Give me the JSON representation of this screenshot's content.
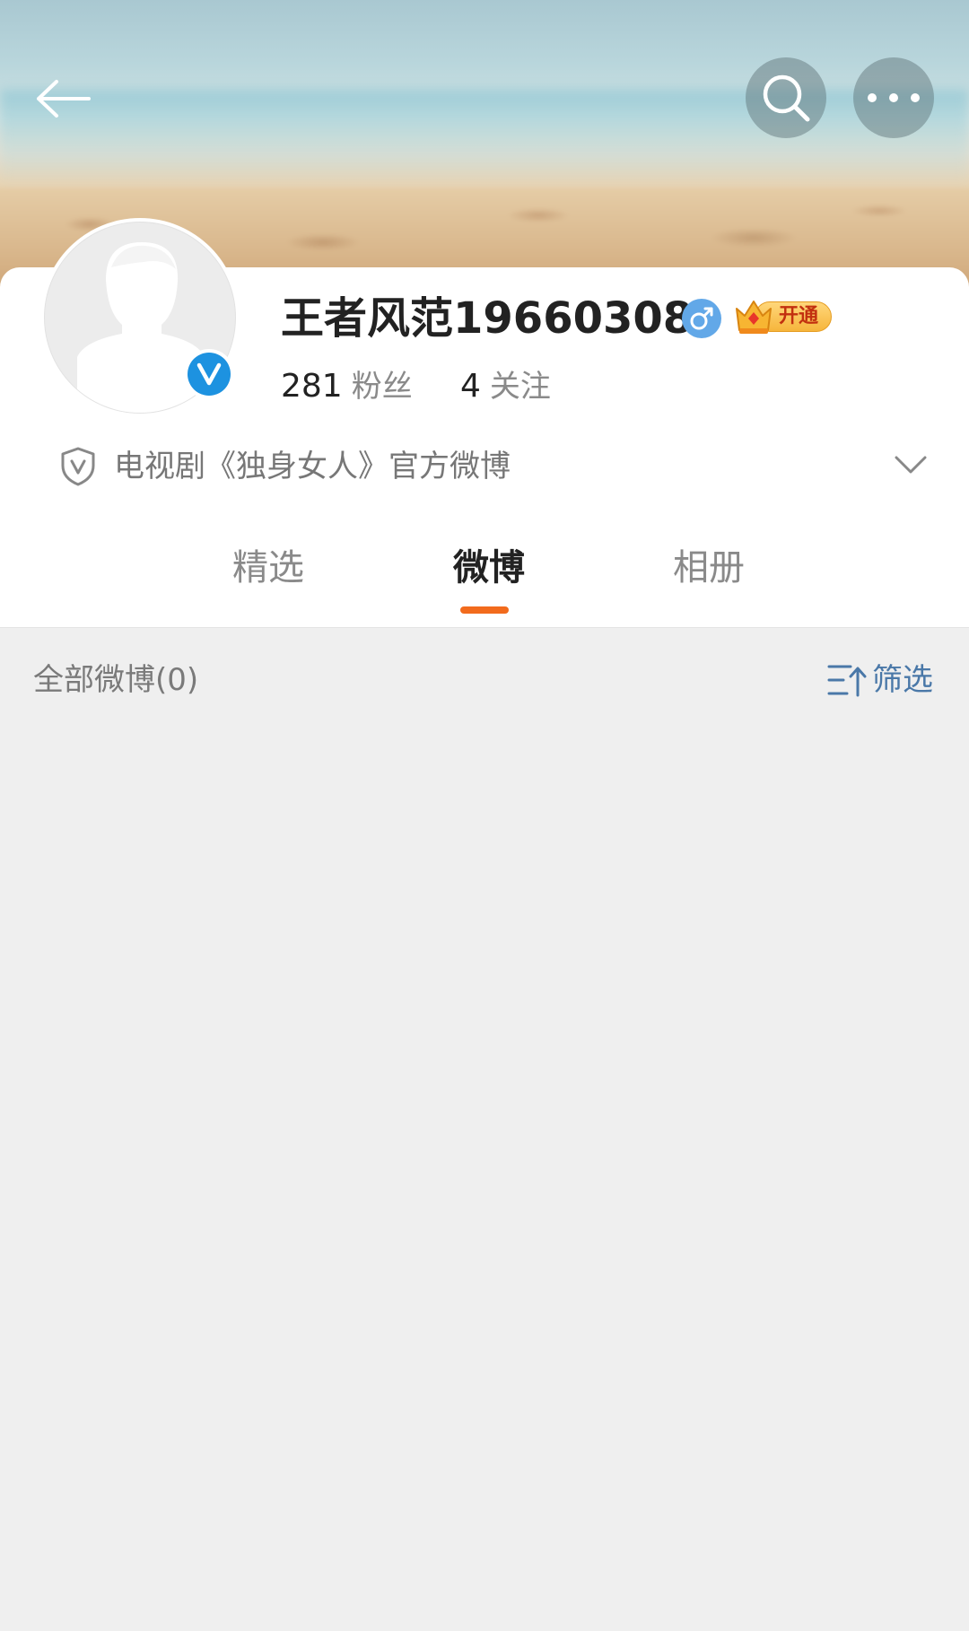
{
  "header": {
    "back_icon": "back-arrow-icon",
    "search_icon": "search-icon",
    "more_icon": "more-dots-icon"
  },
  "profile": {
    "username": "王者风范19660308",
    "verified": true,
    "gender": "male",
    "gender_symbol": "♂",
    "vip_label": "开通",
    "fans_count": "281",
    "fans_label": "粉丝",
    "follow_count": "4",
    "follow_label": "关注",
    "verification_text": "电视剧《独身女人》官方微博"
  },
  "tabs": [
    {
      "label": "精选",
      "active": false
    },
    {
      "label": "微博",
      "active": true
    },
    {
      "label": "相册",
      "active": false
    }
  ],
  "feed": {
    "all_posts_label": "全部微博(0)",
    "filter_label": "筛选"
  },
  "colors": {
    "accent_orange": "#f26b1d",
    "link_blue": "#4a78a8",
    "verified_blue": "#1d92e0",
    "background_gray": "#efefef"
  }
}
